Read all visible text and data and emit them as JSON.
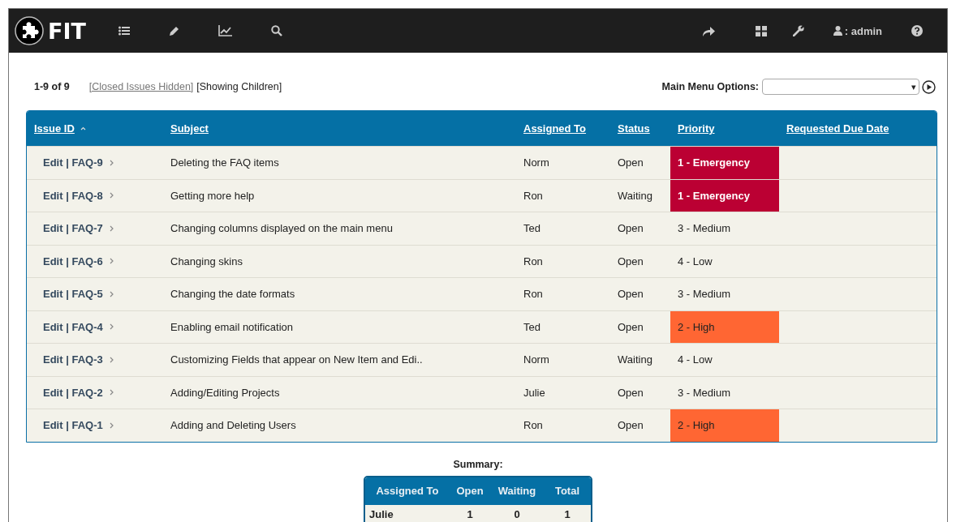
{
  "navbar": {
    "logo": "FIT",
    "user": ": admin"
  },
  "toolbar": {
    "range": "1-9 of 9",
    "closed_link": "[Closed Issues Hidden]",
    "children_note": "[Showing Children]",
    "menu_label": "Main Menu Options:",
    "menu_arrow": "▾"
  },
  "table": {
    "columns": [
      {
        "label": "Issue ID",
        "sorted": true
      },
      {
        "label": "Subject",
        "sorted": false
      },
      {
        "label": "Assigned To",
        "sorted": false
      },
      {
        "label": "Status",
        "sorted": false
      },
      {
        "label": "Priority",
        "sorted": false
      },
      {
        "label": "Requested Due Date",
        "sorted": false
      }
    ],
    "rows": [
      {
        "id": "Edit | FAQ-9",
        "subject": "Deleting the FAQ items",
        "assigned": "Norm",
        "status": "Open",
        "priority": "1 - Emergency",
        "color": "#bb0033"
      },
      {
        "id": "Edit | FAQ-8",
        "subject": "Getting more help",
        "assigned": "Ron",
        "status": "Waiting",
        "priority": "1 - Emergency",
        "color": "#bb0033"
      },
      {
        "id": "Edit | FAQ-7",
        "subject": "Changing columns displayed on the main menu",
        "assigned": "Ted",
        "status": "Open",
        "priority": "3 - Medium"
      },
      {
        "id": "Edit | FAQ-6",
        "subject": "Changing skins",
        "assigned": "Ron",
        "status": "Open",
        "priority": "4 - Low"
      },
      {
        "id": "Edit | FAQ-5",
        "subject": "Changing the date formats",
        "assigned": "Ron",
        "status": "Open",
        "priority": "3 - Medium"
      },
      {
        "id": "Edit | FAQ-4",
        "subject": "Enabling email notification",
        "assigned": "Ted",
        "status": "Open",
        "priority": "2 - High",
        "color": "#ff6633"
      },
      {
        "id": "Edit | FAQ-3",
        "subject": "Customizing Fields that appear on New Item and Edi..",
        "assigned": "Norm",
        "status": "Waiting",
        "priority": "4 - Low"
      },
      {
        "id": "Edit | FAQ-2",
        "subject": "Adding/Editing Projects",
        "assigned": "Julie",
        "status": "Open",
        "priority": "3 - Medium"
      },
      {
        "id": "Edit | FAQ-1",
        "subject": "Adding and Deleting Users",
        "assigned": "Ron",
        "status": "Open",
        "priority": "2 - High",
        "color": "#ff6633"
      }
    ]
  },
  "summary": {
    "title": "Summary:",
    "columns": [
      "Assigned To",
      "Open",
      "Waiting",
      "Total"
    ],
    "rows": [
      [
        "Julie",
        "1",
        "0",
        "1"
      ]
    ]
  }
}
